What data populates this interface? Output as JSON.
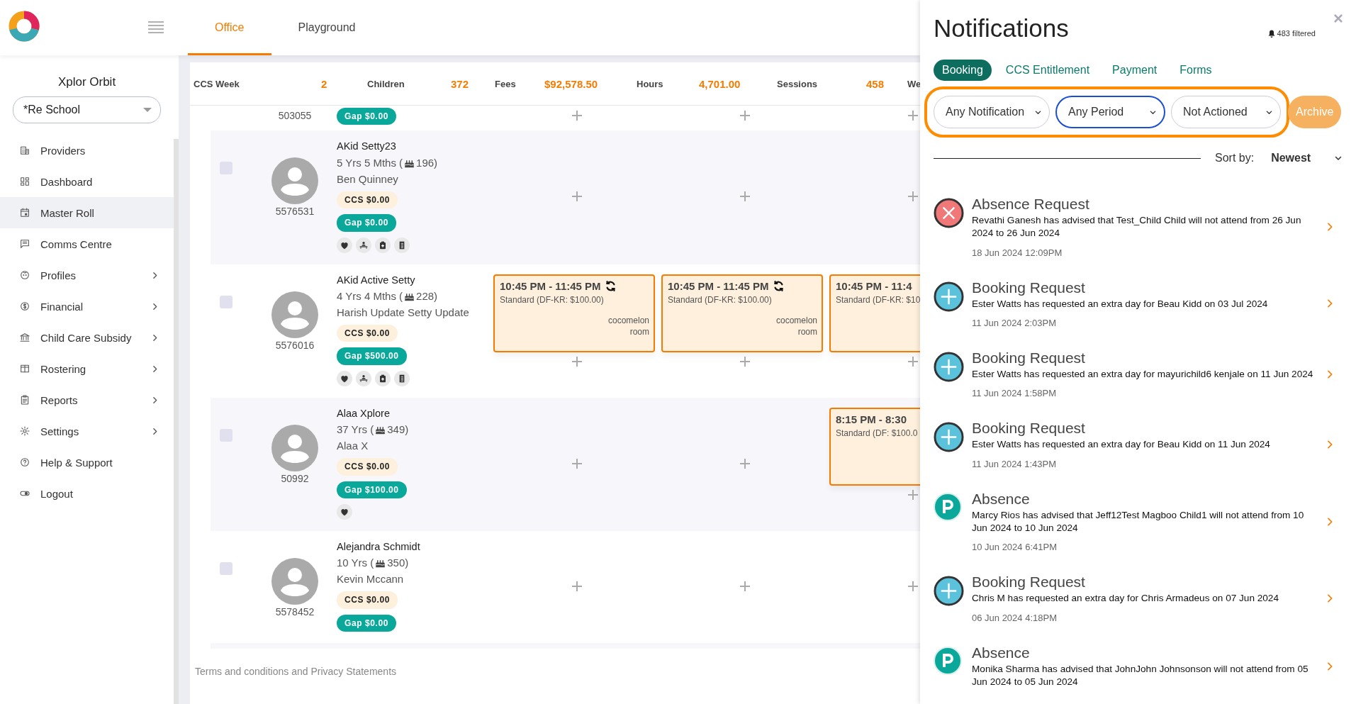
{
  "header": {
    "tabs": [
      {
        "label": "Office",
        "selected": true
      },
      {
        "label": "Playground",
        "selected": false
      }
    ]
  },
  "sidebar": {
    "title": "Xplor Orbit",
    "school_select": {
      "value": "*Re School"
    },
    "items": [
      {
        "kind": "building",
        "label": "Providers",
        "selected": false,
        "expandable": false
      },
      {
        "kind": "dashboard",
        "label": "Dashboard",
        "selected": false,
        "expandable": false
      },
      {
        "kind": "calendar",
        "label": "Master Roll",
        "selected": true,
        "expandable": false
      },
      {
        "kind": "message",
        "label": "Comms Centre",
        "selected": false,
        "expandable": false
      },
      {
        "kind": "face",
        "label": "Profiles",
        "selected": false,
        "expandable": true
      },
      {
        "kind": "dollar",
        "label": "Financial",
        "selected": false,
        "expandable": true
      },
      {
        "kind": "bank",
        "label": "Child Care Subsidy",
        "selected": false,
        "expandable": true
      },
      {
        "kind": "columns",
        "label": "Rostering",
        "selected": false,
        "expandable": true
      },
      {
        "kind": "clipboard",
        "label": "Reports",
        "selected": false,
        "expandable": true
      },
      {
        "kind": "gear",
        "label": "Settings",
        "selected": false,
        "expandable": true
      },
      {
        "kind": "help",
        "label": "Help & Support",
        "selected": false,
        "expandable": false
      },
      {
        "kind": "toggle",
        "label": "Logout",
        "selected": false,
        "expandable": false
      }
    ]
  },
  "stats": [
    {
      "label": "CCS Week",
      "value": "2"
    },
    {
      "label": "Children",
      "value": "372"
    },
    {
      "label": "Fees",
      "value": "$92,578.50"
    },
    {
      "label": "Hours",
      "value": "4,701.00"
    },
    {
      "label": "Sessions",
      "value": "458"
    },
    {
      "label": "We"
    }
  ],
  "rows": [
    {
      "id": "503055",
      "gap": "Gap $0.00",
      "days": [
        {
          "kind": "empty"
        },
        {
          "kind": "empty"
        },
        {
          "kind": "empty"
        }
      ]
    },
    {
      "name": "AKid Setty23",
      "age": "5 Yrs 5 Mths (",
      "age_count": "196)",
      "guardian": "Ben Quinney",
      "ccs": "CCS $0.00",
      "gap": "Gap $0.00",
      "id": "5576531",
      "checked": false,
      "icons": [
        {
          "kind": "heart"
        },
        {
          "kind": "meal"
        },
        {
          "kind": "medical"
        },
        {
          "kind": "notes"
        }
      ],
      "days": [
        {
          "kind": "empty"
        },
        {
          "kind": "empty"
        },
        {
          "kind": "empty"
        }
      ]
    },
    {
      "name": "AKid Active Setty",
      "age": "4 Yrs 4 Mths (",
      "age_count": "228)",
      "guardian": "Harish Update Setty Update",
      "ccs": "CCS $0.00",
      "gap": "Gap $500.00",
      "id": "5576016",
      "checked": false,
      "icons": [
        {
          "kind": "heart"
        },
        {
          "kind": "meal"
        },
        {
          "kind": "medical"
        },
        {
          "kind": "notes"
        }
      ],
      "days": [
        {
          "kind": "booking",
          "booking": {
            "time": "10:45 PM - 11:45 PM",
            "recurring": true,
            "rate": "Standard (DF-KR: $100.00)",
            "room": "cocomelon room"
          }
        },
        {
          "kind": "booking",
          "booking": {
            "time": "10:45 PM - 11:45 PM",
            "recurring": true,
            "rate": "Standard (DF-KR: $100.00)",
            "room": "cocomelon room"
          }
        },
        {
          "kind": "booking",
          "booking": {
            "time": "10:45 PM - 11:4",
            "recurring": false,
            "rate": "Standard (DF-KR: $10"
          }
        }
      ]
    },
    {
      "name": "Alaa Xplore",
      "age": "37 Yrs (",
      "age_count": "349)",
      "guardian": "Alaa X",
      "ccs": "CCS $0.00",
      "gap": "Gap $100.00",
      "id": "50992",
      "checked": false,
      "icons": [
        {
          "kind": "heart"
        }
      ],
      "days": [
        {
          "kind": "empty"
        },
        {
          "kind": "empty"
        },
        {
          "kind": "booking",
          "booking": {
            "time": "8:15 PM - 8:30",
            "recurring": false,
            "rate": "Standard (DF: $100.0"
          }
        }
      ]
    },
    {
      "name": "Alejandra Schmidt",
      "age": "10 Yrs (",
      "age_count": "350)",
      "guardian": "Kevin Mccann",
      "ccs": "CCS $0.00",
      "gap": "Gap $0.00",
      "id": "5578452",
      "checked": false,
      "days": [
        {
          "kind": "empty"
        },
        {
          "kind": "empty"
        },
        {
          "kind": "empty"
        }
      ]
    }
  ],
  "footer": "Terms and conditions and Privacy Statements",
  "notifications_panel": {
    "title": "Notifications",
    "filtered": "483 filtered",
    "tabs": [
      {
        "label": "Booking",
        "selected": true
      },
      {
        "label": "CCS Entitlement",
        "selected": false
      },
      {
        "label": "Payment",
        "selected": false
      },
      {
        "label": "Forms",
        "selected": false
      }
    ],
    "filters": [
      {
        "value": "Any Notification",
        "focused": false
      },
      {
        "value": "Any Period",
        "focused": true
      },
      {
        "value": "Not Actioned",
        "focused": false
      }
    ],
    "archive_button": "Archive",
    "sort_label": "Sort by:",
    "sort_value": "Newest",
    "items": [
      {
        "kind": "cancel",
        "title": "Absence Request",
        "body": "Revathi Ganesh has advised that Test_Child Child will not attend from 26 Jun 2024 to 26 Jun 2024",
        "time": "18 Jun 2024 12:09PM"
      },
      {
        "kind": "add",
        "title": "Booking Request",
        "body": "Ester Watts has requested an extra day for Beau Kidd on 03 Jul 2024",
        "time": "11 Jun 2024 2:03PM"
      },
      {
        "kind": "add",
        "title": "Booking Request",
        "body": "Ester Watts has requested an extra day for mayurichild6 kenjale on 11 Jun 2024",
        "time": "11 Jun 2024 1:58PM"
      },
      {
        "kind": "add",
        "title": "Booking Request",
        "body": "Ester Watts has requested an extra day for Beau Kidd on 11 Jun 2024",
        "time": "11 Jun 2024 1:43PM"
      },
      {
        "kind": "absence",
        "title": "Absence",
        "body": "Marcy Rios has advised that Jeff12Test Magboo Child1 will not attend from 10 Jun 2024 to 10 Jun 2024",
        "time": "10 Jun 2024 6:41PM"
      },
      {
        "kind": "add",
        "title": "Booking Request",
        "body": "Chris M has requested an extra day for Chris Armadeus on 07 Jun 2024",
        "time": "06 Jun 2024 4:18PM"
      },
      {
        "kind": "absence",
        "title": "Absence",
        "body": "Monika Sharma has advised that JohnJohn Johnsonson will not attend from 05 Jun 2024 to 05 Jun 2024"
      }
    ]
  }
}
